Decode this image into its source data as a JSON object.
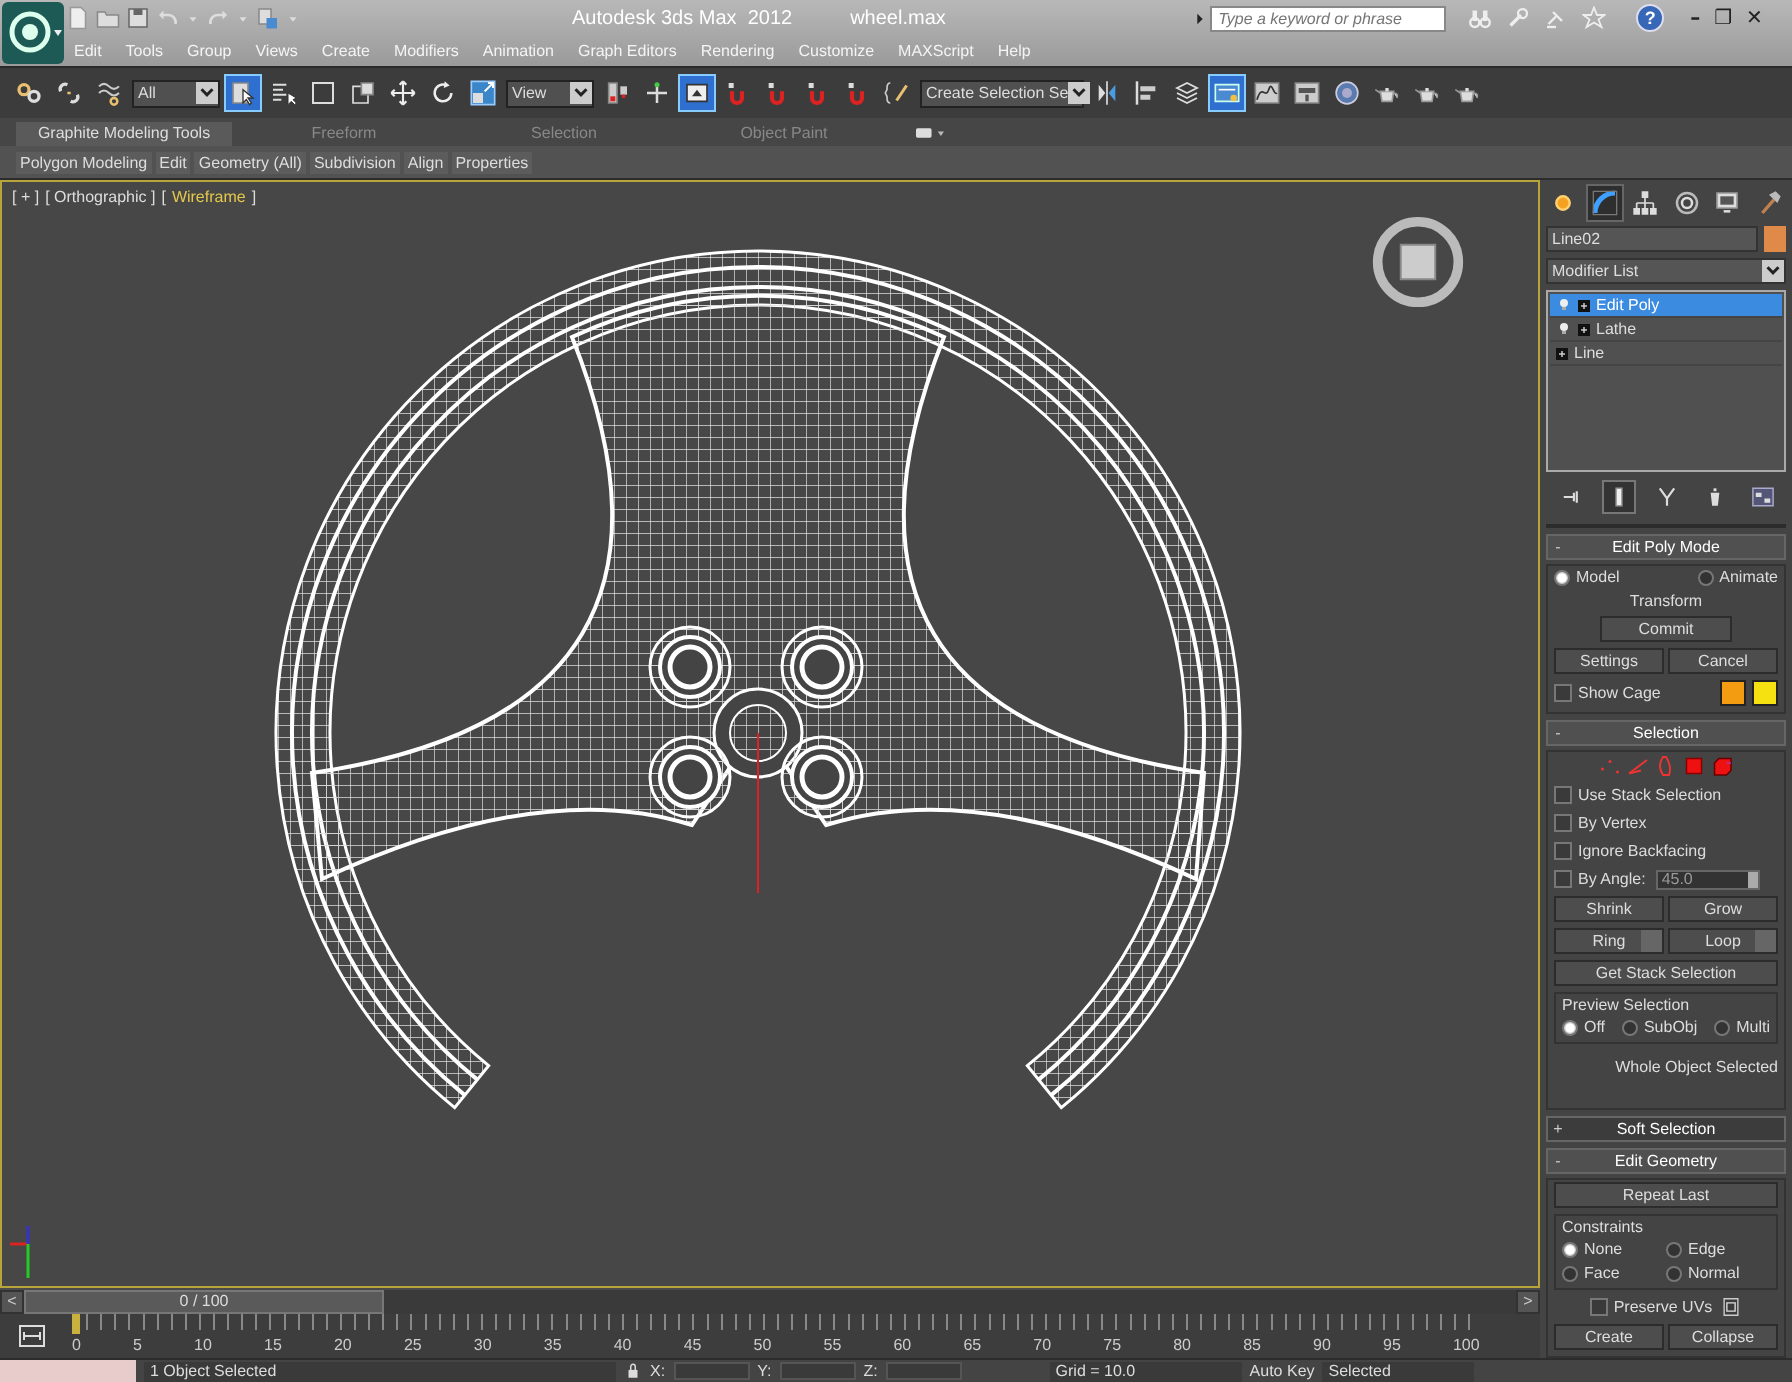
{
  "title_bar": {
    "app_title": "Autodesk 3ds Max  2012",
    "file_name": "wheel.max",
    "search_placeholder": "Type a keyword or phrase",
    "help": "?",
    "window_controls": [
      "–",
      "❐",
      "✕"
    ]
  },
  "menu": [
    "Edit",
    "Tools",
    "Group",
    "Views",
    "Create",
    "Modifiers",
    "Animation",
    "Graph Editors",
    "Rendering",
    "Customize",
    "MAXScript",
    "Help"
  ],
  "main_toolbar": [
    {
      "kind": "icon",
      "selected": false
    },
    {
      "kind": "icon",
      "selected": false
    },
    {
      "kind": "icon",
      "selected": false
    },
    {
      "kind": "dropdown",
      "value": "All"
    },
    {
      "kind": "icon",
      "selected": true
    },
    {
      "kind": "icon",
      "selected": false
    },
    {
      "kind": "icon",
      "selected": false
    },
    {
      "kind": "icon",
      "selected": false
    },
    {
      "kind": "icon",
      "selected": false
    },
    {
      "kind": "icon",
      "selected": false
    },
    {
      "kind": "icon",
      "selected": false
    },
    {
      "kind": "dropdown",
      "value": "View"
    },
    {
      "kind": "icon",
      "selected": false
    },
    {
      "kind": "icon",
      "selected": false
    },
    {
      "kind": "icon",
      "selected": true
    },
    {
      "kind": "icon",
      "selected": false
    },
    {
      "kind": "icon",
      "selected": false
    },
    {
      "kind": "icon",
      "selected": false
    },
    {
      "kind": "icon",
      "selected": false
    },
    {
      "kind": "icon",
      "selected": false
    },
    {
      "kind": "dropdown",
      "value": "Create Selection Se"
    },
    {
      "kind": "icon",
      "selected": false
    },
    {
      "kind": "icon",
      "selected": false
    },
    {
      "kind": "icon",
      "selected": false
    },
    {
      "kind": "icon",
      "selected": true
    },
    {
      "kind": "icon",
      "selected": false
    },
    {
      "kind": "icon",
      "selected": false
    },
    {
      "kind": "icon",
      "selected": false
    },
    {
      "kind": "icon",
      "selected": false
    },
    {
      "kind": "icon",
      "selected": false
    },
    {
      "kind": "icon",
      "selected": false
    }
  ],
  "ribbon": {
    "tabs": [
      {
        "label": "Graphite Modeling Tools",
        "selected": true
      },
      {
        "label": "Freeform",
        "selected": false
      },
      {
        "label": "Selection",
        "selected": false
      },
      {
        "label": "Object Paint",
        "selected": false
      }
    ],
    "panels": [
      "Polygon Modeling",
      "Edit",
      "Geometry (All)",
      "Subdivision",
      "Align",
      "Properties"
    ]
  },
  "viewport": {
    "labels": [
      {
        "text": "[ + ]",
        "highlighted": false
      },
      {
        "text": "[ Orthographic ]",
        "highlighted": false
      },
      {
        "text": "[",
        "highlighted": false
      },
      {
        "text": "Wireframe",
        "highlighted": true
      },
      {
        "text": "]",
        "highlighted": false
      }
    ]
  },
  "time_slider": {
    "prev": "<",
    "position": "0 / 100",
    "next": ">",
    "level": 0
  },
  "ruler": {
    "labels": [
      "0",
      "5",
      "10",
      "15",
      "20",
      "25",
      "30",
      "35",
      "40",
      "45",
      "50",
      "55",
      "60",
      "65",
      "70",
      "75",
      "80",
      "85",
      "90",
      "95",
      "100"
    ]
  },
  "command_panel": {
    "tabs": [
      {
        "selected": false
      },
      {
        "selected": true
      },
      {
        "selected": false
      },
      {
        "selected": false
      },
      {
        "selected": false
      },
      {
        "selected": false
      }
    ],
    "object_name": "Line02",
    "modifier_list": "Modifier List",
    "stack": [
      {
        "label": "Edit Poly",
        "selected": true,
        "has_toggle": true
      },
      {
        "label": "Lathe",
        "selected": false,
        "has_toggle": true
      },
      {
        "label": "Line",
        "selected": false,
        "has_toggle": false
      }
    ],
    "stack_tools": [
      {
        "selected": false
      },
      {
        "selected": true
      },
      {
        "selected": false
      },
      {
        "selected": false
      },
      {
        "selected": false
      }
    ],
    "edit_poly_mode": {
      "toggle": "-",
      "title": "Edit Poly Mode",
      "expanded": true,
      "modes": [
        {
          "label": "Model",
          "selected": true
        },
        {
          "label": "Animate",
          "selected": false
        }
      ],
      "transform": "Transform",
      "commit": "Commit",
      "settings": "Settings",
      "cancel": "Cancel",
      "show_cage": {
        "label": "Show Cage",
        "checked": false
      }
    },
    "selection": {
      "toggle": "-",
      "title": "Selection",
      "expanded": true,
      "options": [
        {
          "label": "Use Stack Selection",
          "checked": false
        },
        {
          "label": "By Vertex",
          "checked": false
        },
        {
          "label": "Ignore Backfacing",
          "checked": false
        },
        {
          "label": "By Angle:",
          "checked": false
        }
      ],
      "angle": "45.0",
      "shrink": "Shrink",
      "grow": "Grow",
      "ring": "Ring",
      "loop": "Loop",
      "get_stack": "Get Stack Selection",
      "preview": {
        "title": "Preview Selection",
        "options": [
          {
            "label": "Off",
            "selected": true
          },
          {
            "label": "SubObj",
            "selected": false
          },
          {
            "label": "Multi",
            "selected": false
          }
        ]
      },
      "status": "Whole Object Selected"
    },
    "soft_selection": {
      "toggle": "+",
      "title": "Soft Selection",
      "expanded": false
    },
    "edit_geometry": {
      "toggle": "-",
      "title": "Edit Geometry",
      "expanded": true,
      "repeat_last": "Repeat Last",
      "constraints": {
        "title": "Constraints",
        "options": [
          {
            "label": "None",
            "selected": true
          },
          {
            "label": "Edge",
            "selected": false
          },
          {
            "label": "Face",
            "selected": false
          },
          {
            "label": "Normal",
            "selected": false
          }
        ]
      },
      "preserve_uvs": {
        "label": "Preserve UVs",
        "checked": false
      },
      "create": "Create",
      "collapse": "Collapse"
    }
  },
  "status_bar": {
    "selection": "1 Object Selected",
    "coords": [
      "X:",
      "Y:",
      "Z:"
    ],
    "grid": "Grid = 10.0",
    "auto_key": "Auto Key",
    "key_filter": "Selected"
  }
}
